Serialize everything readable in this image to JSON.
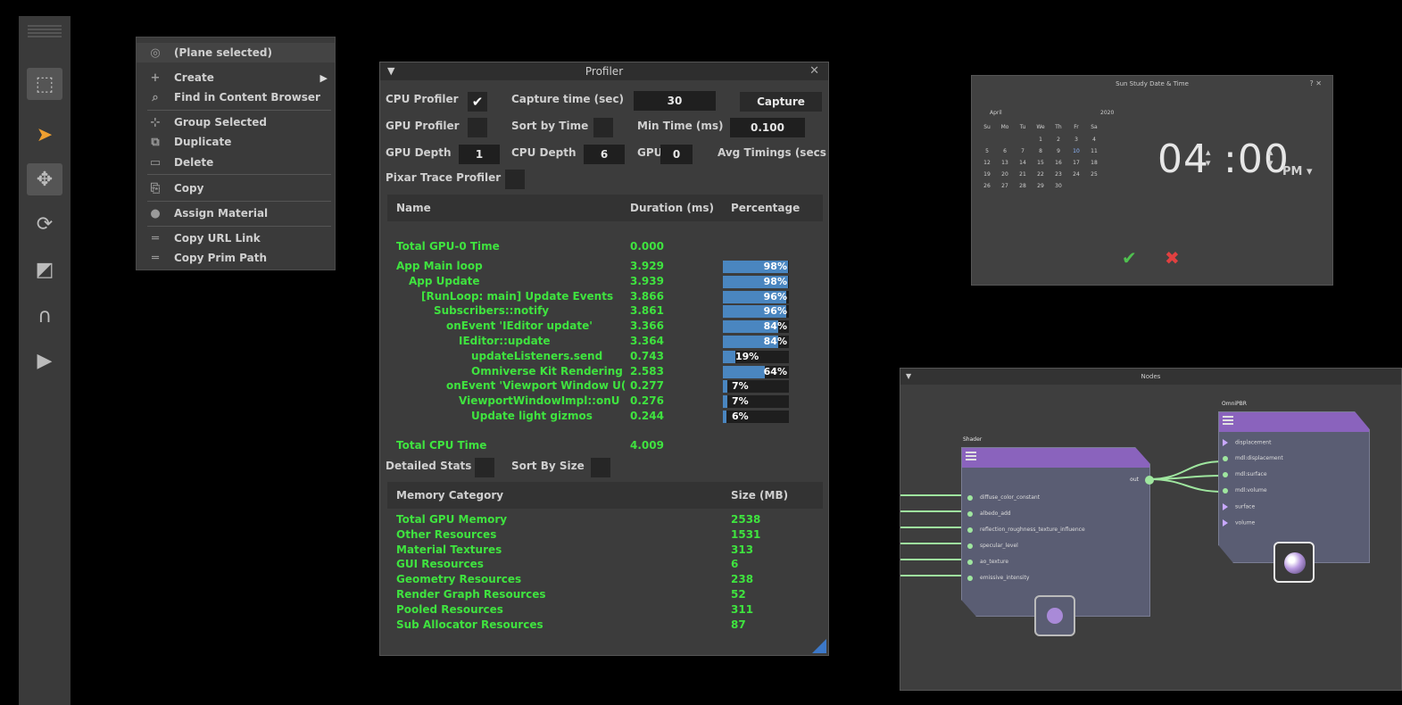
{
  "toolbar": {
    "tools": [
      {
        "icon": "select-target-icon",
        "glyph": "⬚"
      },
      {
        "icon": "cursor-arrow-icon",
        "glyph": "➤"
      },
      {
        "icon": "move-icon",
        "glyph": "✥"
      },
      {
        "icon": "rotate-icon",
        "glyph": "⟳"
      },
      {
        "icon": "scale-icon",
        "glyph": "◩"
      },
      {
        "icon": "snap-magnet-icon",
        "glyph": "∩"
      },
      {
        "icon": "play-icon",
        "glyph": "▶"
      }
    ]
  },
  "context_menu": {
    "items": [
      {
        "label": "(Plane selected)",
        "icon": "plane-icon",
        "glyph": "◎"
      },
      {
        "label": "Create",
        "icon": "plus-icon",
        "glyph": "+"
      },
      {
        "label": "Find in Content Browser",
        "icon": "magnifier-icon",
        "glyph": "⌕"
      },
      {
        "label": "Group Selected",
        "icon": "group-icon",
        "glyph": "⊹"
      },
      {
        "label": "Duplicate",
        "icon": "duplicate-icon",
        "glyph": "⧉"
      },
      {
        "label": "Delete",
        "icon": "trash-icon",
        "glyph": "▭"
      },
      {
        "label": "Copy",
        "icon": "copy-icon",
        "glyph": "⎘"
      },
      {
        "label": "Assign Material",
        "icon": "material-dot-icon",
        "glyph": "●"
      },
      {
        "label": "Copy URL Link",
        "icon": "link-icon",
        "glyph": "═"
      },
      {
        "label": "Copy Prim Path",
        "icon": "path-icon",
        "glyph": "═"
      }
    ],
    "submenu_arrow": "▶"
  },
  "profiler": {
    "title": "Profiler",
    "collapse": "▼",
    "close": "✕",
    "cpu_profiler_label": "CPU Profiler",
    "cpu_profiler_check": "✔",
    "capture_time_label": "Capture time (sec)",
    "capture_time_value": "30",
    "capture_button": "Capture",
    "gpu_profiler_label": "GPU Profiler",
    "sort_by_time_label": "Sort by Time",
    "min_time_label": "Min Time (ms)",
    "min_time_value": "0.100",
    "gpu_depth_label": "GPU Depth",
    "gpu_depth_value": "1",
    "cpu_depth_label": "CPU Depth",
    "cpu_depth_value": "6",
    "gpu_label": "GPU",
    "gpu_value": "0",
    "avg_timings_label": "Avg Timings (secs",
    "pixar_label": "Pixar Trace Profiler",
    "table_headers": {
      "name": "Name",
      "duration": "Duration (ms)",
      "percentage": "Percentage"
    },
    "total_gpu": {
      "name": "Total GPU-0 Time",
      "value": "0.000"
    },
    "rows": [
      {
        "name": "App Main loop",
        "indent": 0,
        "value": "3.929",
        "pct": "98%",
        "fraction": 0.98
      },
      {
        "name": "App Update",
        "indent": 1,
        "value": "3.939",
        "pct": "98%",
        "fraction": 0.98
      },
      {
        "name": "[RunLoop: main] Update Events",
        "indent": 2,
        "value": "3.866",
        "pct": "96%",
        "fraction": 0.96
      },
      {
        "name": "Subscribers::notify",
        "indent": 3,
        "value": "3.861",
        "pct": "96%",
        "fraction": 0.96
      },
      {
        "name": "onEvent 'IEditor update'",
        "indent": 4,
        "value": "3.366",
        "pct": "84%",
        "fraction": 0.84
      },
      {
        "name": "IEditor::update",
        "indent": 5,
        "value": "3.364",
        "pct": "84%",
        "fraction": 0.84
      },
      {
        "name": "updateListeners.send",
        "indent": 6,
        "value": "0.743",
        "pct": "19%",
        "fraction": 0.19
      },
      {
        "name": "Omniverse Kit Rendering",
        "indent": 6,
        "value": "2.583",
        "pct": "64%",
        "fraction": 0.64
      },
      {
        "name": "onEvent 'Viewport Window U(",
        "indent": 4,
        "value": "0.277",
        "pct": "7%",
        "fraction": 0.07
      },
      {
        "name": "ViewportWindowImpl::onU",
        "indent": 5,
        "value": "0.276",
        "pct": "7%",
        "fraction": 0.07
      },
      {
        "name": "Update light gizmos",
        "indent": 6,
        "value": "0.244",
        "pct": "6%",
        "fraction": 0.06
      }
    ],
    "total_cpu": {
      "name": "Total CPU Time",
      "value": "4.009"
    },
    "detailed_stats_label": "Detailed Stats",
    "sort_by_size_label": "Sort By Size",
    "memory_headers": {
      "category": "Memory Category",
      "size": "Size (MB)"
    },
    "memory_rows": [
      {
        "name": "Total GPU Memory",
        "value": "2538"
      },
      {
        "name": "Other Resources",
        "value": "1531"
      },
      {
        "name": "Material Textures",
        "value": "313"
      },
      {
        "name": "GUI Resources",
        "value": "6"
      },
      {
        "name": "Geometry Resources",
        "value": "238"
      },
      {
        "name": "Render Graph Resources",
        "value": "52"
      },
      {
        "name": "Pooled Resources",
        "value": "311"
      },
      {
        "name": "Sub Allocator Resources",
        "value": "87"
      }
    ]
  },
  "sun_study": {
    "title": "Sun Study Date & Time",
    "title_icons": "? ✕",
    "month": "April",
    "year": "2020",
    "weekdays": [
      "Su",
      "Mo",
      "Tu",
      "We",
      "Th",
      "Fr",
      "Sa"
    ],
    "weeks": [
      [
        "",
        "",
        "",
        "1",
        "2",
        "3",
        "4"
      ],
      [
        "5",
        "6",
        "7",
        "8",
        "9",
        "10",
        "11"
      ],
      [
        "12",
        "13",
        "14",
        "15",
        "16",
        "17",
        "18"
      ],
      [
        "19",
        "20",
        "21",
        "22",
        "23",
        "24",
        "25"
      ],
      [
        "26",
        "27",
        "28",
        "29",
        "30",
        "",
        ""
      ]
    ],
    "hour": "04",
    "separator": ":",
    "minute": "00",
    "ampm": "PM",
    "ampm_arrow": "▾",
    "spin_up": "▴",
    "spin_down": "▾",
    "ok": "✔",
    "cancel": "✖",
    "ok_color": "#4fc04f",
    "cancel_color": "#e04040"
  },
  "nodes": {
    "title": "Nodes",
    "collapse": "▼",
    "shader": {
      "title": "Shader",
      "out_label": "out",
      "inputs": [
        "diffuse_color_constant",
        "albedo_add",
        "reflection_roughness_texture_influence",
        "specular_level",
        "ao_texture",
        "emissive_intensity"
      ]
    },
    "omnipbr": {
      "title": "OmniPBR",
      "inputs": [
        "displacement",
        "mdl:displacement",
        "mdl:surface",
        "mdl:volume",
        "surface",
        "volume"
      ]
    }
  }
}
